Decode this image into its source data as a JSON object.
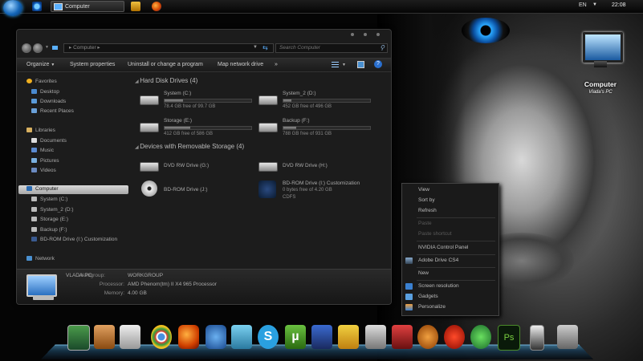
{
  "taskbar": {
    "window_button_label": "Computer",
    "language": "EN",
    "clock": "22:08"
  },
  "explorer": {
    "address": "Computer",
    "search_placeholder": "Search Computer",
    "commands": [
      "Organize",
      "System properties",
      "Uninstall or change a program",
      "Map network drive"
    ],
    "more_glyph": "»",
    "nav": {
      "favorites": "Favorites",
      "desktop": "Desktop",
      "downloads": "Downloads",
      "recent": "Recent Places",
      "libraries": "Libraries",
      "documents": "Documents",
      "music": "Music",
      "pictures": "Pictures",
      "videos": "Videos",
      "computer": "Computer",
      "system_c": "System (C:)",
      "system2_d": "System_2 (D:)",
      "storage_e": "Storage (E:)",
      "backup_f": "Backup (F:)",
      "bdrom_i": "BD-ROM Drive (I:) Customization",
      "network": "Network"
    },
    "hdd_header": "Hard Disk Drives (4)",
    "hdd": [
      {
        "name": "System (C:)",
        "free": "78.4 GB free of 99.7 GB",
        "used_fraction": 0.21
      },
      {
        "name": "System_2 (D:)",
        "free": "452 GB free of 496 GB",
        "used_fraction": 0.09
      },
      {
        "name": "Storage (E:)",
        "free": "412 GB free of 586 GB",
        "used_fraction": 0.3
      },
      {
        "name": "Backup (F:)",
        "free": "788 GB free of 931 GB",
        "used_fraction": 0.15
      }
    ],
    "removable_header": "Devices with Removable Storage (4)",
    "removable": [
      {
        "name": "DVD RW Drive (G:)"
      },
      {
        "name": "DVD RW Drive (H:)"
      },
      {
        "name": "BD-ROM Drive (J:)"
      },
      {
        "name": "BD-ROM Drive (I:) Customization",
        "line2": "0 bytes free of 4.20 GB",
        "line3": "CDFS"
      }
    ],
    "details": {
      "pc_name": "VLADA-PC",
      "workgroup_label": "Workgroup:",
      "workgroup": "WORKGROUP",
      "processor_label": "Processor:",
      "processor": "AMD Phenom(tm) II X4 965 Processor",
      "memory_label": "Memory:",
      "memory": "4.00 GB"
    }
  },
  "desktop_icon": {
    "label": "Computer",
    "sub": "Vlada's PC"
  },
  "context_menu": {
    "items": [
      "View",
      "Sort by",
      "Refresh",
      "Paste",
      "Paste shortcut",
      "NVIDIA Control Panel",
      "Adobe Drive CS4",
      "New",
      "Screen resolution",
      "Gadgets",
      "Personalize"
    ]
  },
  "dock": {
    "icons": [
      "desktop-icon",
      "folder-icon",
      "photos-icon",
      "chrome-icon",
      "firefox-icon",
      "thunderbird-icon",
      "messenger-icon",
      "skype-icon",
      "utorrent-icon",
      "video-icon",
      "winamp-icon",
      "satellite-icon",
      "calendar-icon",
      "media-player-icon",
      "orb-icon",
      "globe-icon",
      "photoshop-icon",
      "iphone-icon",
      "tools-icon"
    ],
    "photoshop_glyph": "Ps",
    "utorrent_glyph": "µ",
    "skype_glyph": "S"
  }
}
